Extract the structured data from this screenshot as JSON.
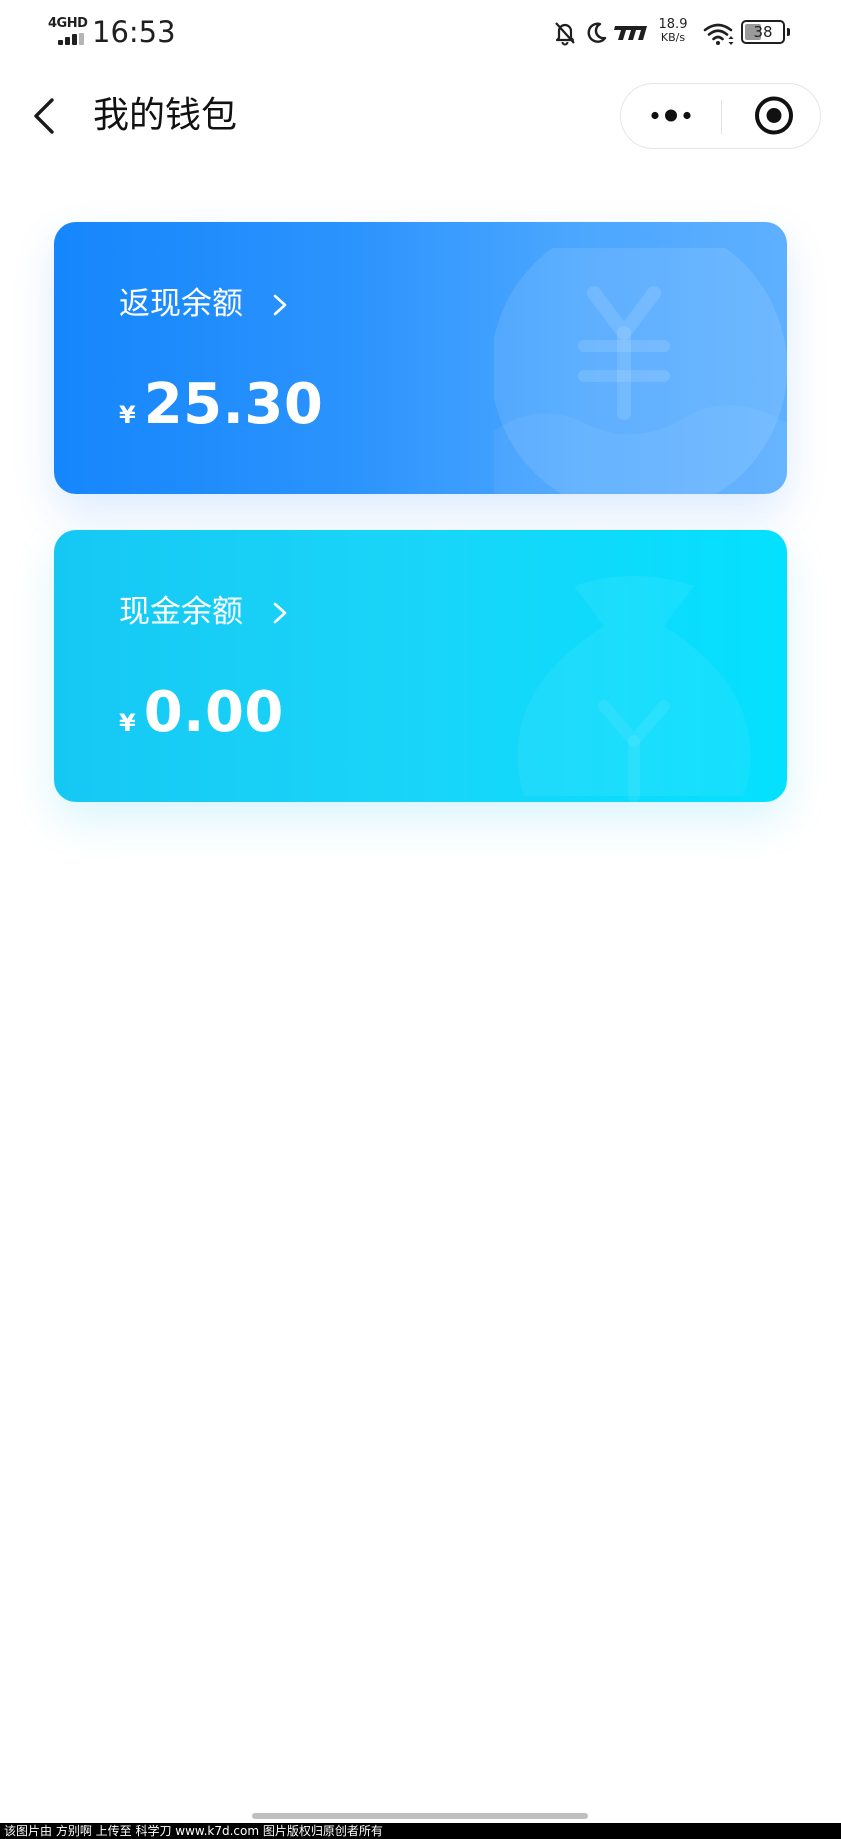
{
  "status_bar": {
    "network": "4GHD",
    "time": "16:53",
    "speed_value": "18.9",
    "speed_unit": "KB/s",
    "battery": "38",
    "icons": [
      "mute-bell-icon",
      "moon-icon",
      "carrier-logo-icon",
      "wifi-icon",
      "battery-icon"
    ]
  },
  "nav": {
    "title": "我的钱包",
    "back_icon": "chevron-left-icon",
    "more_icon": "more-dots-icon",
    "close_icon": "target-circle-icon"
  },
  "cards": [
    {
      "label": "返现余额",
      "chevron": ">",
      "currency": "¥",
      "amount": "25.30",
      "gradient": [
        "#1586fc",
        "#5eb0ff"
      ]
    },
    {
      "label": "现金余额",
      "chevron": ">",
      "currency": "¥",
      "amount": "0.00",
      "gradient": [
        "#15c8f4",
        "#04e0ff"
      ]
    }
  ],
  "footer": {
    "text": "该图片由 方别啊 上传至 科学刀 www.k7d.com 图片版权归原创者所有"
  }
}
